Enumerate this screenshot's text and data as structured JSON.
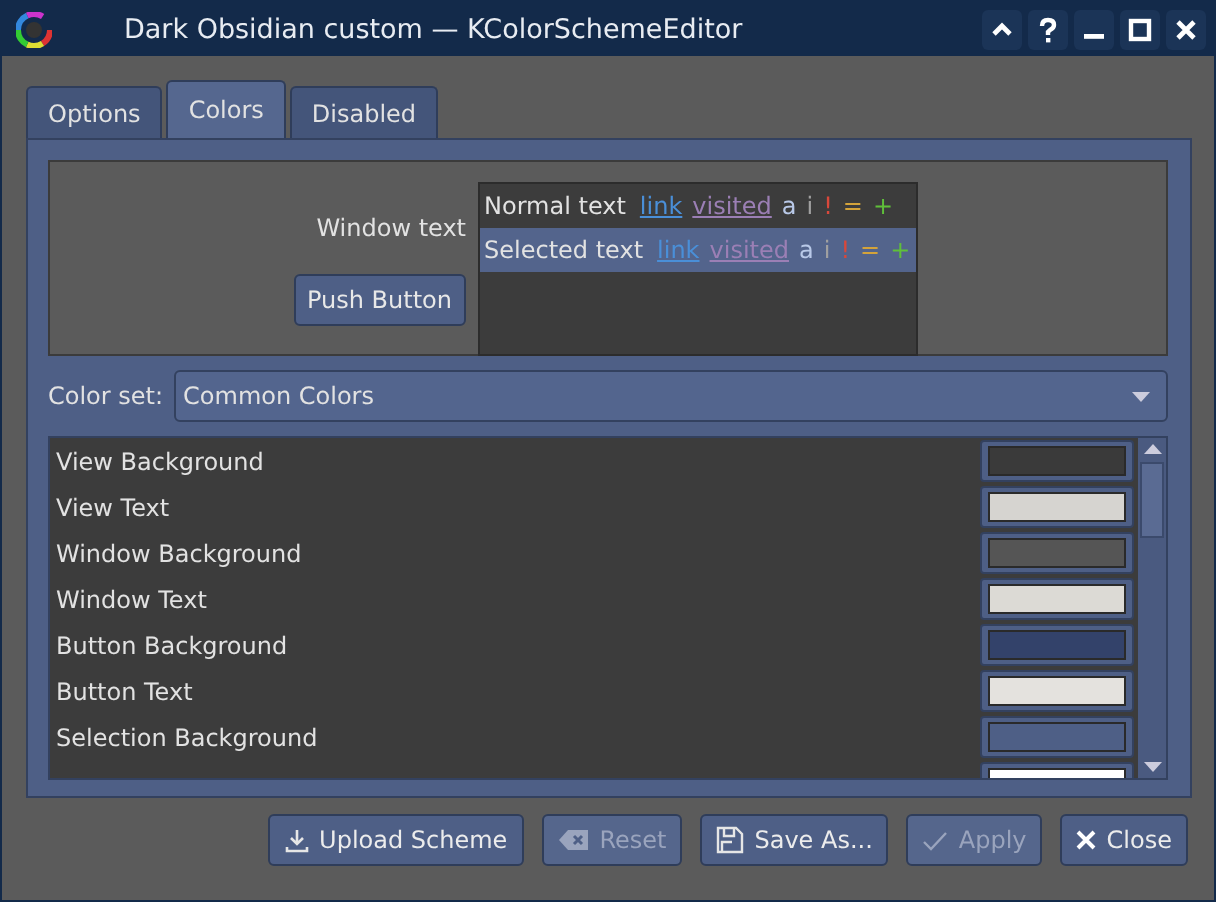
{
  "window": {
    "title": "Dark Obsidian custom — KColorSchemeEditor"
  },
  "tabs": [
    {
      "label": "Options",
      "selected": false
    },
    {
      "label": "Colors",
      "selected": true
    },
    {
      "label": "Disabled",
      "selected": false
    }
  ],
  "preview": {
    "label": "Window text",
    "button": "Push Button",
    "rows": [
      {
        "selected": false,
        "label": "Normal text",
        "items": [
          {
            "text": "link",
            "kind": "link"
          },
          {
            "text": "visited",
            "kind": "visited"
          },
          {
            "text": "a",
            "kind": "active"
          },
          {
            "text": "i",
            "kind": "inactive"
          },
          {
            "text": "!",
            "kind": "negative"
          },
          {
            "text": "=",
            "kind": "neutral"
          },
          {
            "text": "+",
            "kind": "positive"
          }
        ]
      },
      {
        "selected": true,
        "label": "Selected text",
        "items": [
          {
            "text": "link",
            "kind": "link"
          },
          {
            "text": "visited",
            "kind": "visited"
          },
          {
            "text": "a",
            "kind": "active"
          },
          {
            "text": "i",
            "kind": "inactive"
          },
          {
            "text": "!",
            "kind": "negative"
          },
          {
            "text": "=",
            "kind": "neutral"
          },
          {
            "text": "+",
            "kind": "positive"
          }
        ]
      }
    ]
  },
  "color_set": {
    "label": "Color set:",
    "value": "Common Colors"
  },
  "colors": [
    {
      "label": "View Background",
      "color": "#3a3a3a"
    },
    {
      "label": "View Text",
      "color": "#d6d4d0"
    },
    {
      "label": "Window Background",
      "color": "#555555"
    },
    {
      "label": "Window Text",
      "color": "#dcdad5"
    },
    {
      "label": "Button Background",
      "color": "#33426a"
    },
    {
      "label": "Button Text",
      "color": "#e4e2de"
    },
    {
      "label": "Selection Background",
      "color": "#4e5f86"
    },
    {
      "color": "#ffffff"
    }
  ],
  "buttons": [
    {
      "label": "Upload Scheme",
      "kind": "upload",
      "disabled": false
    },
    {
      "label": "Reset",
      "kind": "clear",
      "disabled": true
    },
    {
      "label": "Save As...",
      "kind": "save",
      "disabled": false
    },
    {
      "label": "Apply",
      "kind": "check",
      "disabled": true
    },
    {
      "label": "Close",
      "kind": "close",
      "disabled": false
    }
  ]
}
